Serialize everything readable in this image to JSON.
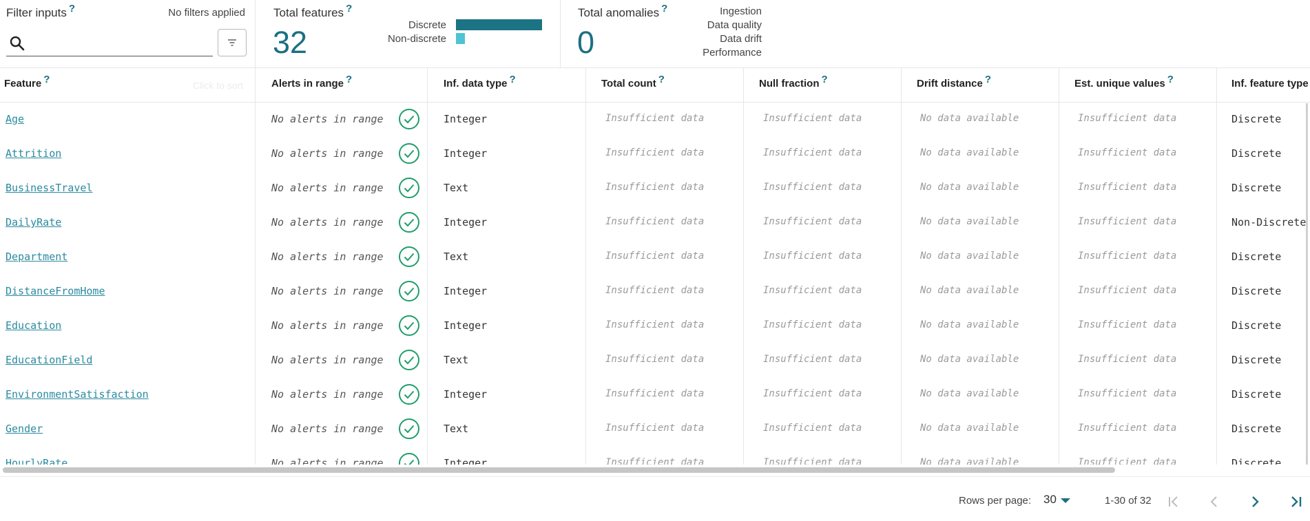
{
  "filter": {
    "title": "Filter inputs",
    "help": "?",
    "status": "No filters applied",
    "search_placeholder": "",
    "search_value": ""
  },
  "total_features": {
    "title": "Total features",
    "help": "?",
    "value": "32",
    "bars": [
      {
        "label": "Discrete",
        "color": "#1c7383",
        "fraction": 0.87
      },
      {
        "label": "Non-discrete",
        "color": "#4fc3d4",
        "fraction": 0.09
      }
    ]
  },
  "total_anomalies": {
    "title": "Total anomalies",
    "help": "?",
    "value": "0",
    "categories": [
      "Ingestion",
      "Data quality",
      "Data drift",
      "Performance"
    ]
  },
  "table": {
    "sort_hint": "Click to sort",
    "columns": [
      {
        "label": "Feature",
        "help": "?"
      },
      {
        "label": "Alerts in range",
        "help": "?"
      },
      {
        "label": "Inf. data type",
        "help": "?"
      },
      {
        "label": "Total count",
        "help": "?"
      },
      {
        "label": "Null fraction",
        "help": "?"
      },
      {
        "label": "Drift distance",
        "help": "?"
      },
      {
        "label": "Est. unique values",
        "help": "?"
      },
      {
        "label": "Inf. feature type",
        "help": ""
      }
    ],
    "rows": [
      {
        "feature": "Age",
        "alerts": "No alerts in range",
        "dtype": "Integer",
        "total_count": "Insufficient data",
        "null_fraction": "Insufficient data",
        "drift": "No data available",
        "unique": "Insufficient data",
        "ftype": "Discrete"
      },
      {
        "feature": "Attrition",
        "alerts": "No alerts in range",
        "dtype": "Integer",
        "total_count": "Insufficient data",
        "null_fraction": "Insufficient data",
        "drift": "No data available",
        "unique": "Insufficient data",
        "ftype": "Discrete"
      },
      {
        "feature": "BusinessTravel",
        "alerts": "No alerts in range",
        "dtype": "Text",
        "total_count": "Insufficient data",
        "null_fraction": "Insufficient data",
        "drift": "No data available",
        "unique": "Insufficient data",
        "ftype": "Discrete"
      },
      {
        "feature": "DailyRate",
        "alerts": "No alerts in range",
        "dtype": "Integer",
        "total_count": "Insufficient data",
        "null_fraction": "Insufficient data",
        "drift": "No data available",
        "unique": "Insufficient data",
        "ftype": "Non-Discrete"
      },
      {
        "feature": "Department",
        "alerts": "No alerts in range",
        "dtype": "Text",
        "total_count": "Insufficient data",
        "null_fraction": "Insufficient data",
        "drift": "No data available",
        "unique": "Insufficient data",
        "ftype": "Discrete"
      },
      {
        "feature": "DistanceFromHome",
        "alerts": "No alerts in range",
        "dtype": "Integer",
        "total_count": "Insufficient data",
        "null_fraction": "Insufficient data",
        "drift": "No data available",
        "unique": "Insufficient data",
        "ftype": "Discrete"
      },
      {
        "feature": "Education",
        "alerts": "No alerts in range",
        "dtype": "Integer",
        "total_count": "Insufficient data",
        "null_fraction": "Insufficient data",
        "drift": "No data available",
        "unique": "Insufficient data",
        "ftype": "Discrete"
      },
      {
        "feature": "EducationField",
        "alerts": "No alerts in range",
        "dtype": "Text",
        "total_count": "Insufficient data",
        "null_fraction": "Insufficient data",
        "drift": "No data available",
        "unique": "Insufficient data",
        "ftype": "Discrete"
      },
      {
        "feature": "EnvironmentSatisfaction",
        "alerts": "No alerts in range",
        "dtype": "Integer",
        "total_count": "Insufficient data",
        "null_fraction": "Insufficient data",
        "drift": "No data available",
        "unique": "Insufficient data",
        "ftype": "Discrete"
      },
      {
        "feature": "Gender",
        "alerts": "No alerts in range",
        "dtype": "Text",
        "total_count": "Insufficient data",
        "null_fraction": "Insufficient data",
        "drift": "No data available",
        "unique": "Insufficient data",
        "ftype": "Discrete"
      },
      {
        "feature": "HourlyRate",
        "alerts": "No alerts in range",
        "dtype": "Integer",
        "total_count": "Insufficient data",
        "null_fraction": "Insufficient data",
        "drift": "No data available",
        "unique": "Insufficient data",
        "ftype": "Discrete"
      }
    ]
  },
  "pagination": {
    "rows_per_page_label": "Rows per page:",
    "rows_per_page_value": "30",
    "range_text": "1-30 of 32"
  },
  "colors": {
    "accent": "#1c6f82",
    "link": "#2a8aa0",
    "check": "#1f9e6a"
  },
  "icons": [
    "search-icon",
    "filter-icon",
    "help-icon",
    "check-circle-icon",
    "caret-down-icon",
    "first-page-icon",
    "previous-page-icon",
    "next-page-icon",
    "last-page-icon"
  ]
}
